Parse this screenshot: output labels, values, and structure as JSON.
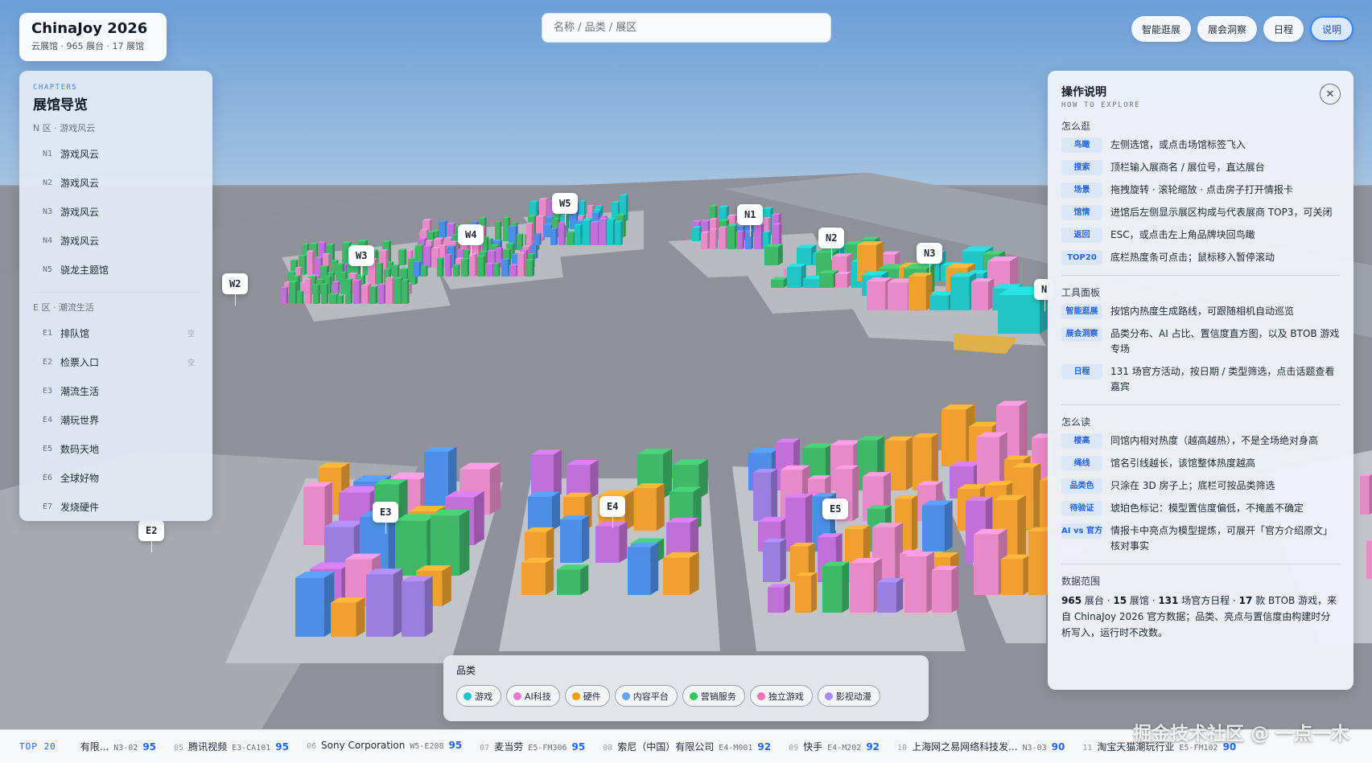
{
  "brand": {
    "title": "ChinaJoy 2026",
    "subtitle": "云展馆 · 965 展台 · 17 展馆"
  },
  "search": {
    "placeholder": "名称 / 品类 / 展区"
  },
  "top_actions": [
    "智能逛展",
    "展会洞察",
    "日程",
    "说明"
  ],
  "active_action": "说明",
  "chapters": {
    "kicker": "CHAPTERS",
    "title": "展馆导览",
    "groups": [
      {
        "label": "N 区 · 游戏风云",
        "items": [
          {
            "code": "N1",
            "name": "游戏风云",
            "tag": ""
          },
          {
            "code": "N2",
            "name": "游戏风云",
            "tag": ""
          },
          {
            "code": "N3",
            "name": "游戏风云",
            "tag": ""
          },
          {
            "code": "N4",
            "name": "游戏风云",
            "tag": ""
          },
          {
            "code": "N5",
            "name": "骁龙主题馆",
            "tag": ""
          }
        ]
      },
      {
        "label": "E 区 · 潮流生活",
        "items": [
          {
            "code": "E1",
            "name": "排队馆",
            "tag": "空"
          },
          {
            "code": "E2",
            "name": "检票入口",
            "tag": "空"
          },
          {
            "code": "E3",
            "name": "潮流生活",
            "tag": ""
          },
          {
            "code": "E4",
            "name": "潮玩世界",
            "tag": ""
          },
          {
            "code": "E5",
            "name": "数码天地",
            "tag": ""
          },
          {
            "code": "E6",
            "name": "全球好物",
            "tag": ""
          },
          {
            "code": "E7",
            "name": "发烧硬件",
            "tag": ""
          }
        ]
      }
    ]
  },
  "help": {
    "title": "操作说明",
    "subtitle": "HOW TO EXPLORE",
    "sections": [
      {
        "title": "怎么逛",
        "rows": [
          {
            "tag": "鸟瞰",
            "text": "左侧选馆，或点击场馆标签飞入"
          },
          {
            "tag": "搜索",
            "text": "顶栏输入展商名 / 展位号，直达展台"
          },
          {
            "tag": "场景",
            "text": "拖拽旋转 · 滚轮缩放 · 点击房子打开情报卡"
          },
          {
            "tag": "馆情",
            "text": "进馆后左侧显示展区构成与代表展商 TOP3，可关闭"
          },
          {
            "tag": "返回",
            "text": "ESC，或点击左上角品牌块回鸟瞰"
          },
          {
            "tag": "TOP20",
            "text": "底栏热度条可点击；鼠标移入暂停滚动"
          }
        ]
      },
      {
        "title": "工具面板",
        "rows": [
          {
            "tag": "智能逛展",
            "text": "按馆内热度生成路线，可跟随相机自动巡览"
          },
          {
            "tag": "展会洞察",
            "text": "品类分布、AI 占比、置信度直方图，以及 BTOB 游戏专场"
          },
          {
            "tag": "日程",
            "text": "131 场官方活动，按日期 / 类型筛选，点击话题查看嘉宾"
          }
        ]
      },
      {
        "title": "怎么读",
        "rows": [
          {
            "tag": "楼高",
            "text": "同馆内相对热度（越高越热），不是全场绝对身高"
          },
          {
            "tag": "绳线",
            "text": "馆名引线越长，该馆整体热度越高"
          },
          {
            "tag": "品类色",
            "text": "只涂在 3D 房子上；底栏可按品类筛选"
          },
          {
            "tag": "待验证",
            "text": "琥珀色标记：模型置信度偏低，不掩盖不确定"
          },
          {
            "tag": "AI vs 官方",
            "text": "情报卡中亮点为模型提炼，可展开「官方介绍原文」核对事实"
          }
        ]
      }
    ],
    "data_scope": {
      "title": "数据范围",
      "booths": "965",
      "booths_unit": "展台 · ",
      "halls": "15",
      "halls_unit": "展馆 · ",
      "events": "131",
      "events_unit": "场官方日程 · ",
      "games": "17",
      "games_unit": "款 BTOB 游戏，来自 ChinaJoy 2026 官方数据；品类、亮点与置信度由构建时分析写入，运行时不改数。"
    }
  },
  "categories": {
    "label": "品类",
    "items": [
      {
        "name": "游戏",
        "color": "#22c5c5"
      },
      {
        "name": "AI科技",
        "color": "#e879d0"
      },
      {
        "name": "硬件",
        "color": "#f59e0b"
      },
      {
        "name": "内容平台",
        "color": "#60a5fa"
      },
      {
        "name": "营销服务",
        "color": "#34c759"
      },
      {
        "name": "独立游戏",
        "color": "#f472b6"
      },
      {
        "name": "影视动漫",
        "color": "#a78bfa"
      }
    ]
  },
  "ticker": {
    "head": "TOP 20",
    "items": [
      {
        "rank": "",
        "name": "有限...",
        "booth": "N3-02",
        "score": "95"
      },
      {
        "rank": "05",
        "name": "腾讯视频",
        "booth": "E3-CA101",
        "score": "95"
      },
      {
        "rank": "06",
        "name": "Sony Corporation",
        "booth": "W5-E208",
        "score": "95"
      },
      {
        "rank": "07",
        "name": "麦当劳",
        "booth": "E5-FM306",
        "score": "95"
      },
      {
        "rank": "08",
        "name": "索尼（中国）有限公司",
        "booth": "E4-M001",
        "score": "92"
      },
      {
        "rank": "09",
        "name": "快手",
        "booth": "E4-M202",
        "score": "92"
      },
      {
        "rank": "10",
        "name": "上海网之易网络科技发...",
        "booth": "N3-03",
        "score": "90"
      },
      {
        "rank": "11",
        "name": "淘宝天猫潮玩行业",
        "booth": "E5-FM102",
        "score": "90"
      }
    ]
  },
  "halls": [
    "W2",
    "W3",
    "W4",
    "W5",
    "N1",
    "N2",
    "N3",
    "N",
    "E2",
    "E3",
    "E4",
    "E5"
  ],
  "watermark": "掘金技术社区 @ 一点一木",
  "palette": {
    "orange": "#f0a030",
    "pink": "#e88ac8",
    "magenta": "#c070d8",
    "blue": "#4d8ee6",
    "green": "#3fb86a",
    "teal": "#22c5c5",
    "purple": "#9b7fe0",
    "gray": "#8d96a6"
  }
}
